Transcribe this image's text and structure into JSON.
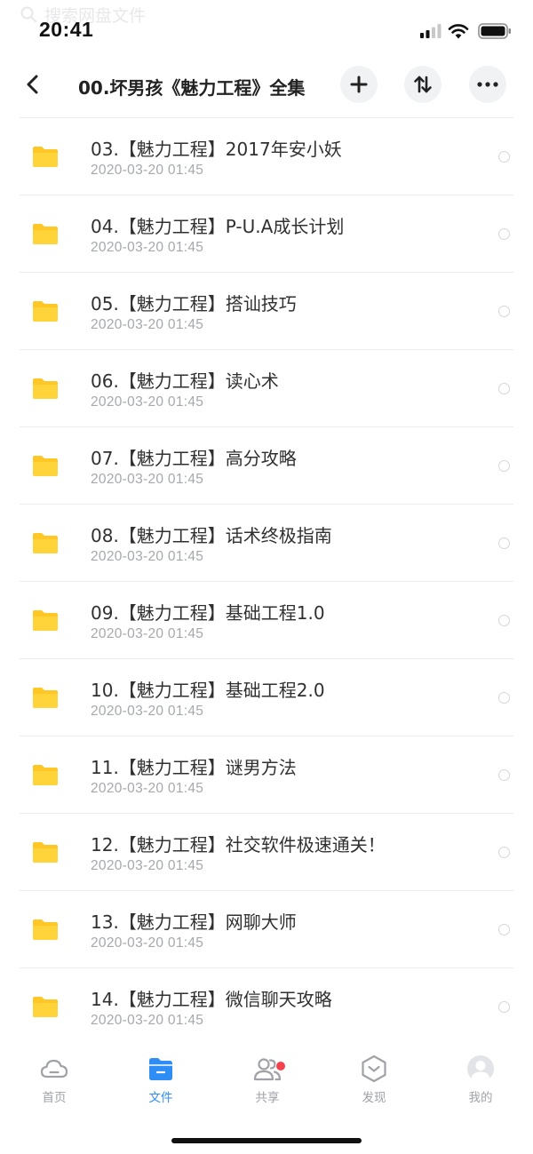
{
  "status_bar": {
    "time": "20:41"
  },
  "search": {
    "placeholder": "搜索网盘文件"
  },
  "nav": {
    "title": "00.坏男孩《魅力工程》全集"
  },
  "files": [
    {
      "name": "03.【魅力工程】2017年安小妖",
      "date": "2020-03-20 01:45"
    },
    {
      "name": "04.【魅力工程】P-U.A成长计划",
      "date": "2020-03-20 01:45"
    },
    {
      "name": "05.【魅力工程】搭讪技巧",
      "date": "2020-03-20 01:45"
    },
    {
      "name": "06.【魅力工程】读心术",
      "date": "2020-03-20 01:45"
    },
    {
      "name": "07.【魅力工程】高分攻略",
      "date": "2020-03-20 01:45"
    },
    {
      "name": "08.【魅力工程】话术终极指南",
      "date": "2020-03-20 01:45"
    },
    {
      "name": "09.【魅力工程】基础工程1.0",
      "date": "2020-03-20 01:45"
    },
    {
      "name": "10.【魅力工程】基础工程2.0",
      "date": "2020-03-20 01:45"
    },
    {
      "name": "11.【魅力工程】谜男方法",
      "date": "2020-03-20 01:45"
    },
    {
      "name": "12.【魅力工程】社交软件极速通关！",
      "date": "2020-03-20 01:45"
    },
    {
      "name": "13.【魅力工程】网聊大师",
      "date": "2020-03-20 01:45"
    },
    {
      "name": "14.【魅力工程】微信聊天攻略",
      "date": "2020-03-20 01:45"
    }
  ],
  "tabs": [
    {
      "label": "首页",
      "icon": "cloud-icon",
      "active": false
    },
    {
      "label": "文件",
      "icon": "folder-icon",
      "active": true
    },
    {
      "label": "共享",
      "icon": "people-icon",
      "active": false,
      "badge": true
    },
    {
      "label": "发现",
      "icon": "discover-icon",
      "active": false
    },
    {
      "label": "我的",
      "icon": "avatar-icon",
      "active": false
    }
  ],
  "colors": {
    "accent": "#2f8df6",
    "folder": "#ffc726",
    "badge": "#f5424b",
    "tab_inactive": "#a0a2a8"
  }
}
